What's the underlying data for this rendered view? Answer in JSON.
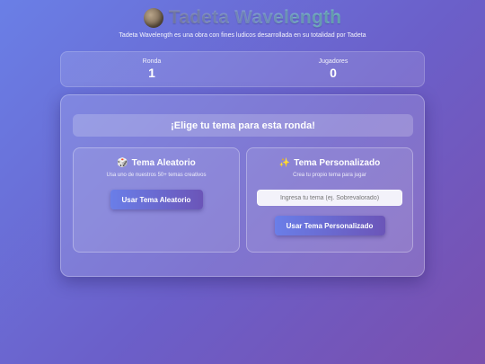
{
  "header": {
    "title": "Tadeta Wavelength",
    "icon": "planet-icon",
    "subtitle": "Tadeta Wavelength es una obra con fines ludicos desarrollada en su totalidad por Tadeta"
  },
  "stats": {
    "round_label": "Ronda",
    "round_value": "1",
    "players_label": "Jugadores",
    "players_value": "0"
  },
  "main": {
    "prompt": "¡Elige tu tema para esta ronda!",
    "random": {
      "icon": "🎲",
      "title": "Tema Aleatorio",
      "description": "Usa uno de nuestros 50+ temas creativos",
      "button_label": "Usar Tema Aleatorio"
    },
    "custom": {
      "icon": "✨",
      "title": "Tema Personalizado",
      "description": "Crea tu propio tema para jugar",
      "input_placeholder": "Ingresa tu tema (ej. Sobrevalorado)",
      "input_value": "",
      "button_label": "Usar Tema Personalizado"
    }
  },
  "colors": {
    "bg_start": "#6a7fe6",
    "bg_end": "#7a4fae",
    "button_start": "#6a7ee8",
    "button_end": "#6b55b8"
  }
}
